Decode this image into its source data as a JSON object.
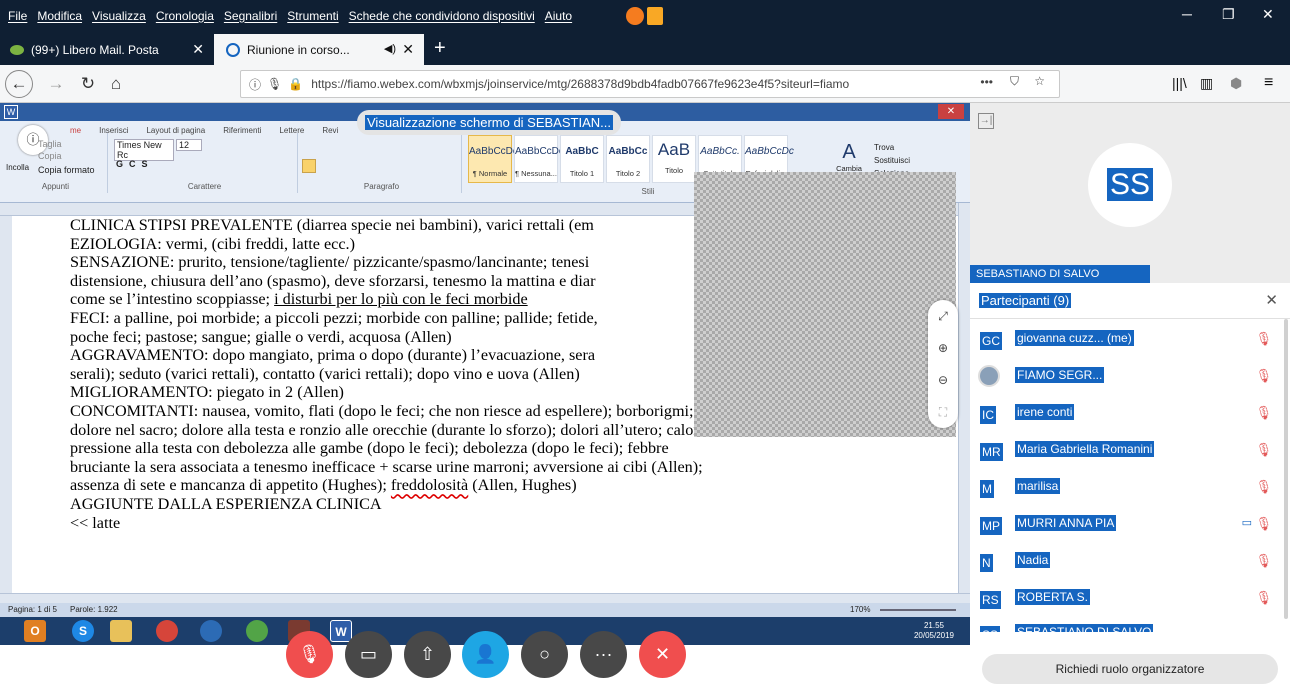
{
  "menu": [
    "File",
    "Modifica",
    "Visualizza",
    "Cronologia",
    "Segnalibri",
    "Strumenti",
    "Schede che condividono dispositivi",
    "Aiuto"
  ],
  "tabs": [
    {
      "label": "(99+) Libero Mail. Posta"
    },
    {
      "label": "Riunione in corso..."
    }
  ],
  "url": "https://fiamo.webex.com/wbxmjs/joinservice/mtg/2688378d9bdb4fadb07667fe9623e4f5?siteurl=fiamo",
  "sharing_banner": "Visualizzazione schermo di SEBASTIAN...",
  "word": {
    "tabs": [
      "me",
      "Inserisci",
      "Layout di pagina",
      "Riferimenti",
      "Lettere",
      "Revi"
    ],
    "clipboard": {
      "paste": "Incolla",
      "cut": "Taglia",
      "copy": "Copia",
      "format": "Copia formato",
      "label": "Appunti"
    },
    "font": {
      "name": "Times New Rc",
      "size": "12",
      "label": "Carattere"
    },
    "paragraph_label": "Paragrafo",
    "styles": [
      {
        "preview": "AaBbCcDc",
        "name": "¶ Normale"
      },
      {
        "preview": "AaBbCcDc",
        "name": "¶ Nessuna..."
      },
      {
        "preview": "AaBbC",
        "name": "Titolo 1"
      },
      {
        "preview": "AaBbCc",
        "name": "Titolo 2"
      },
      {
        "preview": "AaB",
        "name": "Titolo"
      },
      {
        "preview": "AaBbCc.",
        "name": "Sottotitolo"
      },
      {
        "preview": "AaBbCcDc",
        "name": "Enfasi deli..."
      }
    ],
    "styles_label": "Stili",
    "change_styles": "Cambia stili",
    "edit": {
      "find": "Trova",
      "replace": "Sostituisci",
      "select": "Seleziona"
    },
    "status": {
      "page": "Pagina: 1 di 5",
      "words": "Parole: 1.922",
      "zoom": "170%"
    },
    "clock": {
      "time": "21.55",
      "date": "20/05/2019"
    }
  },
  "document_lines": [
    "CLINICA  STIPSI PREVALENTE (diarrea specie nei bambini), varici rettali (em",
    "EZIOLOGIA: vermi, (cibi freddi, latte ecc.)",
    "SENSAZIONE:  prurito, tensione/tagliente/ pizzicante/spasmo/lancinante;  tenesi",
    "distensione, chiusura dell’ano (spasmo), deve sforzarsi, tenesmo la mattina e diar",
    "come se l’intestino scoppiasse; ",
    "i disturbi per lo più con le feci morbide",
    "FECI: a palline, poi morbide; a piccoli pezzi; morbide con palline; pallide; fetide,",
    "poche feci; pastose; sangue; gialle o verdi, acquosa (Allen)",
    "AGGRAVAMENTO: dopo mangiato, prima o dopo (durante) l’evacuazione, sera",
    "serali); seduto (varici rettali), contatto (varici rettali); dopo vino e uova (Allen)",
    "MIGLIORAMENTO: piegato in 2 (Allen)",
    "CONCOMITANTI: nausea, vomito, flati (dopo le feci; che non riesce ad espellere); borborigmi;",
    "dolore nel sacro; dolore alla testa e ronzio alle orecchie (durante lo sforzo); dolori all’utero; calore e",
    "pressione alla testa con debolezza alle gambe (dopo le feci); debolezza (dopo le feci); febbre",
    "bruciante la sera associata a tenesmo inefficace + scarse urine marroni; avversione ai cibi (Allen);",
    "assenza di sete e mancanza di appetito (Hughes); ",
    "freddolosità",
    " (Allen, Hughes)",
    "AGGIUNTE DALLA ESPERIENZA CLINICA",
    "<< latte"
  ],
  "presenter": {
    "initials": "SS",
    "name": "SEBASTIANO DI SALVO"
  },
  "participants_header": "Partecipanti (9)",
  "participants": [
    {
      "initials": "GC",
      "name": "giovanna cuzz...  (me)",
      "cam": false
    },
    {
      "initials": "",
      "name": "FIAMO SEGR...",
      "cam": false
    },
    {
      "initials": "IC",
      "name": "irene conti",
      "cam": false
    },
    {
      "initials": "MR",
      "name": "Maria Gabriella Romanini",
      "cam": false
    },
    {
      "initials": "M",
      "name": "marilisa",
      "cam": false
    },
    {
      "initials": "MP",
      "name": "MURRI ANNA PIA",
      "cam": true
    },
    {
      "initials": "N",
      "name": "Nadia",
      "cam": false
    },
    {
      "initials": "RS",
      "name": "ROBERTA S.",
      "cam": false
    },
    {
      "initials": "SS",
      "name": "SEBASTIANO DI SALVO",
      "cam": false
    }
  ],
  "organizer_button": "Richiedi ruolo organizzatore",
  "colors": {
    "accent": "#1565c0",
    "mute": "#e35a5a",
    "end": "#f04e4e",
    "active": "#1ea6e4"
  }
}
